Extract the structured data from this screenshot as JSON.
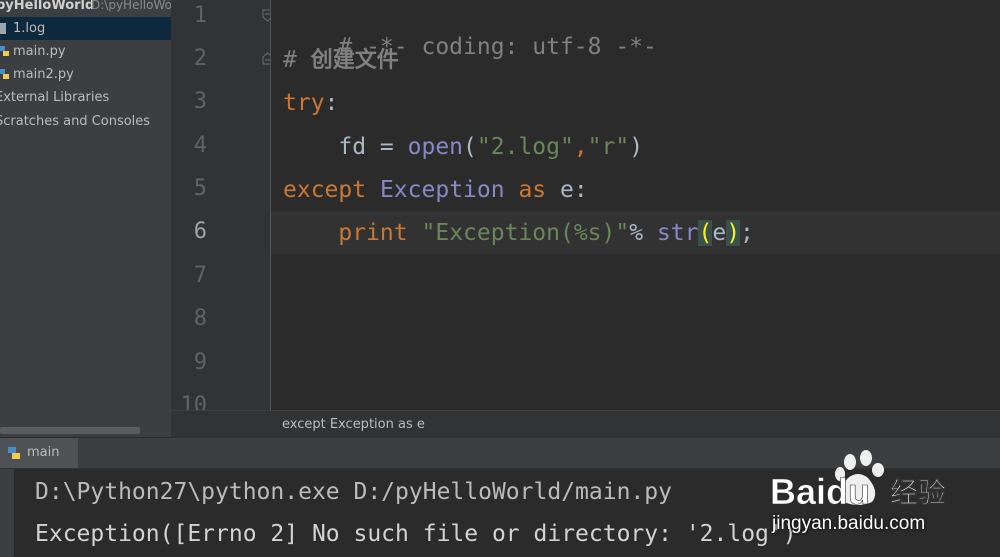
{
  "project": {
    "root_name": "pyHelloWorld",
    "root_path": "D:\\pyHelloWo",
    "items": [
      {
        "label": "1.log",
        "icon": "log-file-icon",
        "selected": true
      },
      {
        "label": "main.py",
        "icon": "python-file-icon"
      },
      {
        "label": "main2.py",
        "icon": "python-file-icon"
      },
      {
        "label": "External Libraries",
        "icon": "library-icon"
      },
      {
        "label": "Scratches and Consoles",
        "icon": "scratches-icon"
      }
    ]
  },
  "editor": {
    "line_numbers": [
      "1",
      "2",
      "3",
      "4",
      "5",
      "6",
      "7",
      "8",
      "9",
      "10"
    ],
    "current_line": 6,
    "lines": {
      "l1": "# -*- coding: utf-8 -*-",
      "l2_hash": "# ",
      "l2_text": "创建文件",
      "l3_kw": "try",
      "l3_colon": ":",
      "l4_indent": "    fd = ",
      "l4_fn": "open",
      "l4_open": "(",
      "l4_s1": "\"2.log\"",
      "l4_comma": ",",
      "l4_s2": "\"r\"",
      "l4_close": ")",
      "l5_kw": "except",
      "l5_cls": "Exception",
      "l5_as": "as",
      "l5_var": " e:",
      "l6_indent": "    ",
      "l6_print": "print",
      "l6_str": "\"Exception(%s)\"",
      "l6_pct": "% ",
      "l6_fn": "str",
      "l6_open": "(",
      "l6_e": "e",
      "l6_close": ")",
      "l6_semi": ";"
    },
    "mouse_cursor": "I"
  },
  "breadcrumb": "except Exception as e",
  "run": {
    "tab_label": "main",
    "tab_icon": "python-run-icon",
    "output": [
      "D:\\Python27\\python.exe D:/pyHelloWorld/main.py",
      "Exception([Errno 2] No such file or directory: '2.log')"
    ]
  },
  "watermark": {
    "brand": "Baidu",
    "brand_cn": "经验",
    "url": "jingyan.baidu.com"
  },
  "colors": {
    "keyword": "#cc7832",
    "string": "#6a8759",
    "builtin": "#8888c6",
    "comment": "#808080",
    "background": "#2b2b2b"
  }
}
